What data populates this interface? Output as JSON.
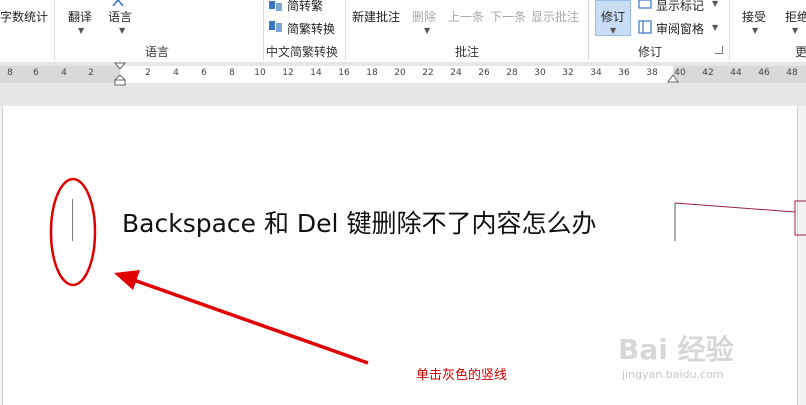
{
  "ribbon": {
    "word_count_label": "字数统计",
    "translate_label": "翻译",
    "language_label": "语言",
    "language_group": "语言",
    "to_traditional": "简转繁",
    "convert_label": "简繁转换",
    "chinese_group": "中文简繁转换",
    "new_comment": "新建批注",
    "delete_label": "删除",
    "previous_label": "上一条",
    "next_label": "下一条",
    "show_comments": "显示批注",
    "comments_group": "批注",
    "track_changes": "修订",
    "show_markup": "显示标记",
    "reviewing_pane": "审阅窗格",
    "tracking_group": "修订",
    "accept_label": "接受",
    "reject_label": "拒绝",
    "changes_group_partial": "更"
  },
  "ruler": {
    "left_ticks": [
      "8",
      "6",
      "4",
      "2"
    ],
    "right_ticks": [
      "2",
      "4",
      "6",
      "8",
      "10",
      "12",
      "14",
      "16",
      "18",
      "20",
      "22",
      "24",
      "26",
      "28",
      "30",
      "32",
      "34",
      "36",
      "38",
      "40",
      "42",
      "44",
      "46",
      "48"
    ]
  },
  "document": {
    "line_text": "Backspace 和 Del 键删除不了内容怎么办"
  },
  "annotation": {
    "caption": "单击灰色的竖线",
    "color": "#e00000"
  },
  "watermark": {
    "logo_text": "Bai 经验",
    "url": "jingyan.baidu.com"
  }
}
